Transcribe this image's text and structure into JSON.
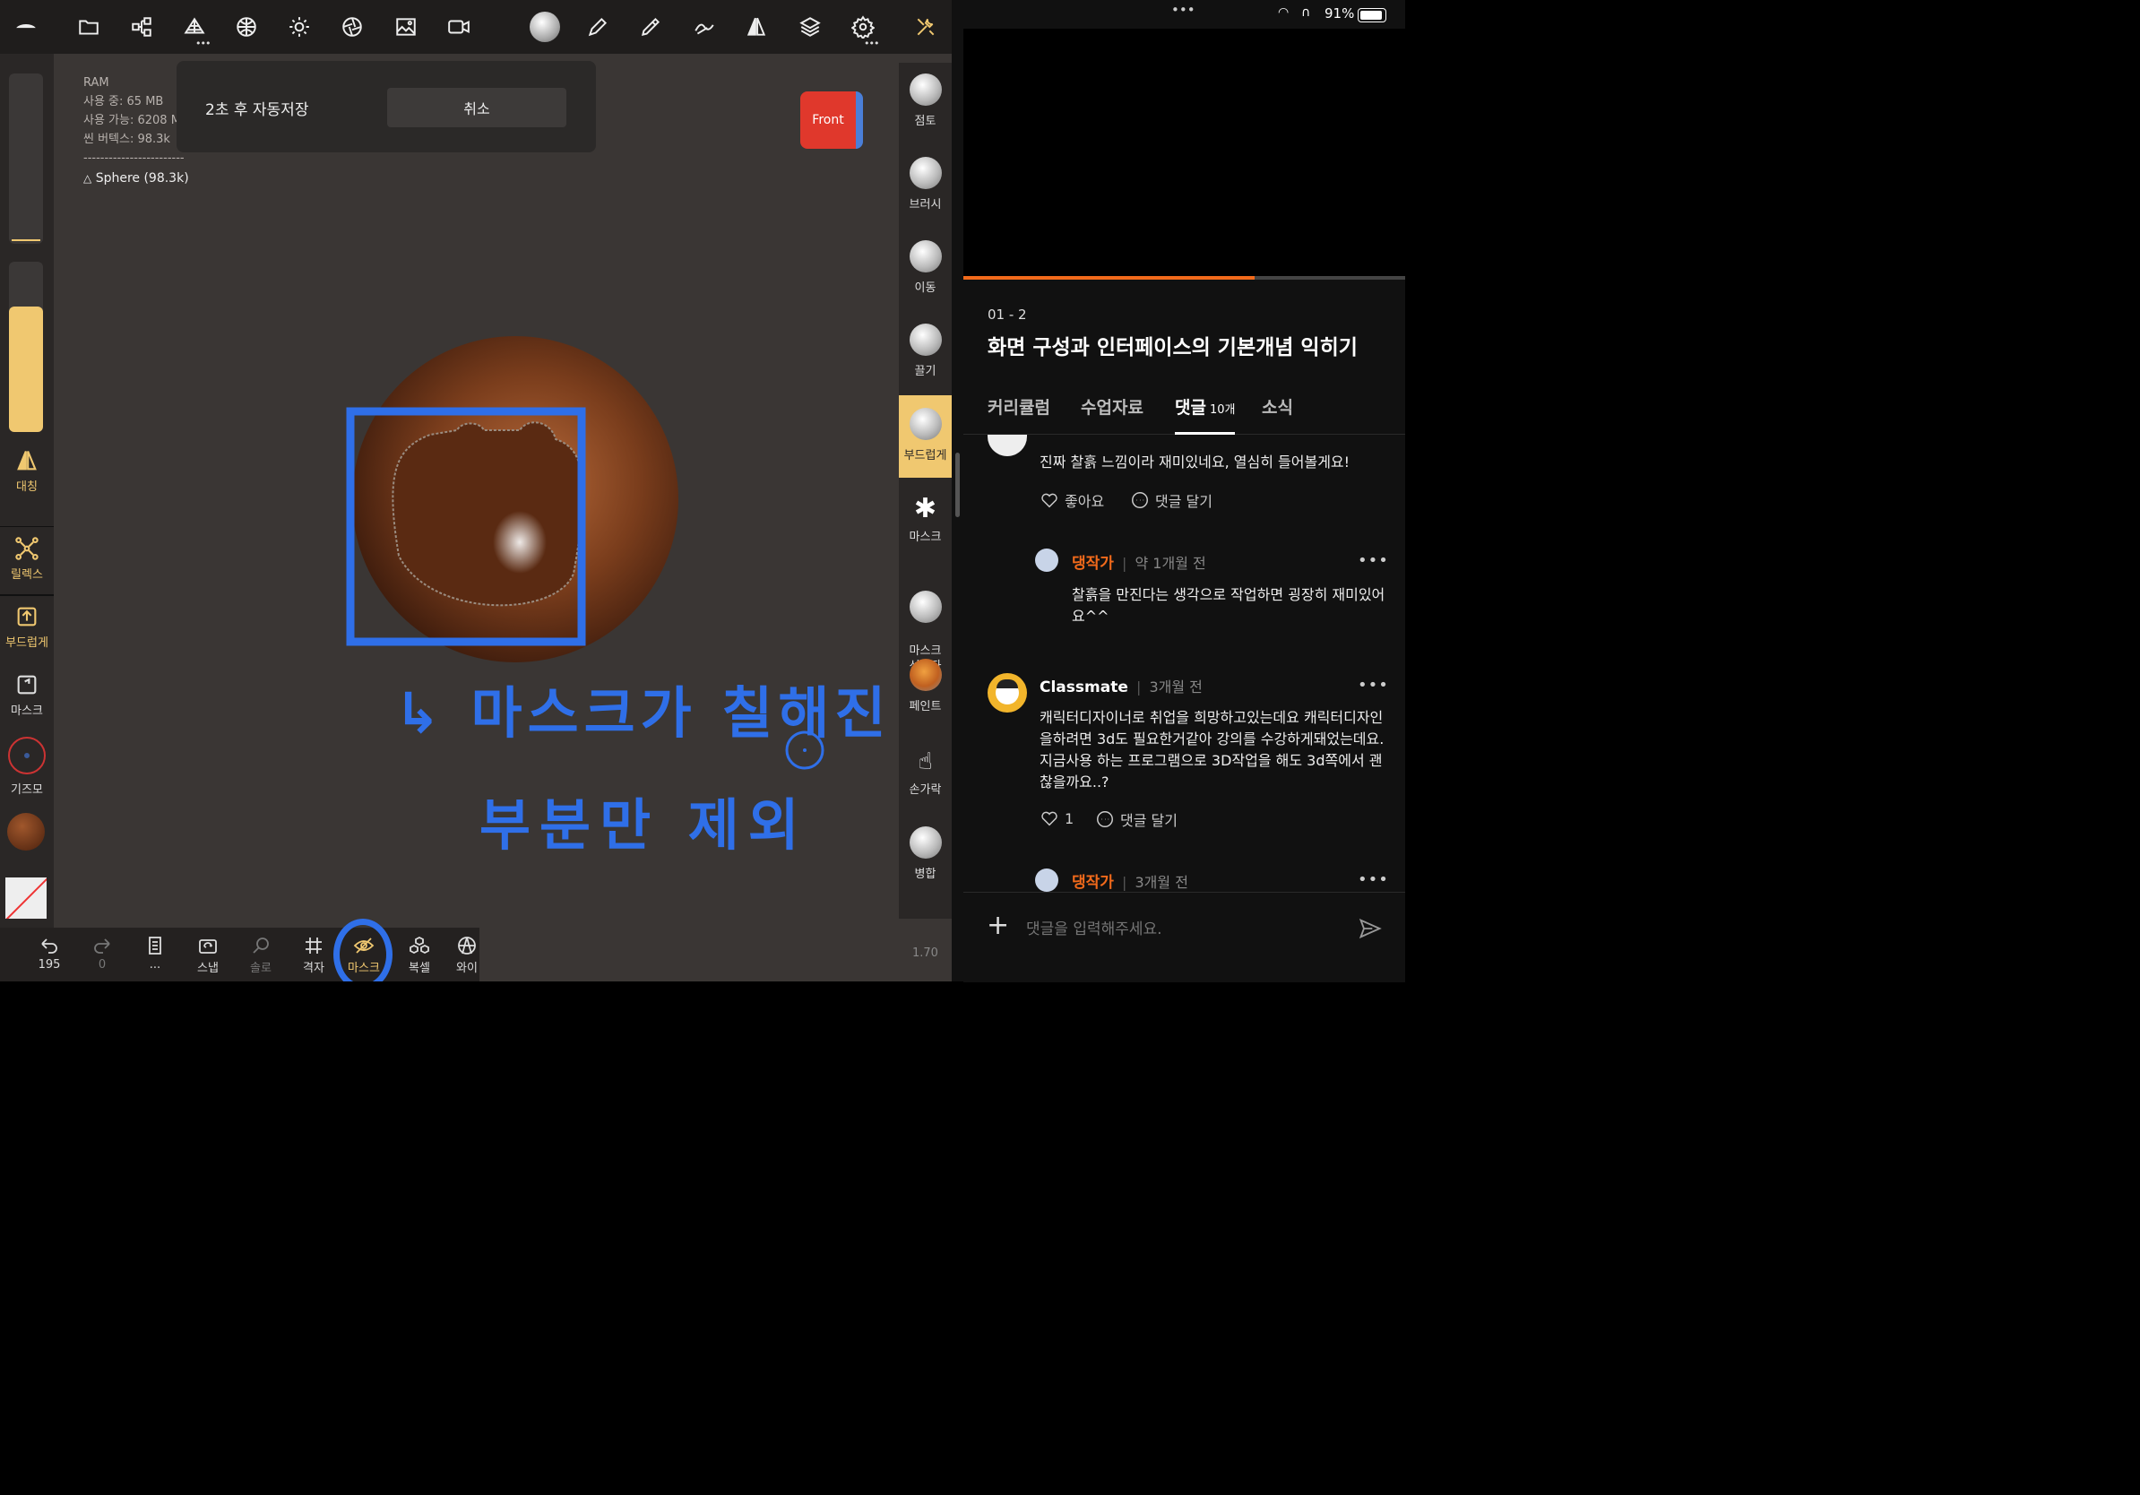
{
  "left_app": {
    "toolbar": {
      "icons": [
        "logo-icon",
        "folder-icon",
        "scene-graph-icon",
        "mesh-icon",
        "sphere-grid-icon",
        "sun-icon",
        "aperture-icon",
        "image-icon",
        "video-icon",
        "sphere-brush-icon",
        "pen-icon",
        "brush-icon",
        "stroke-icon",
        "mirror-icon",
        "layers-icon",
        "settings-icon",
        "tools-icon"
      ]
    },
    "stats": {
      "ram_label": "RAM",
      "used": "사용 중: 65 MB",
      "available": "사용 가능: 6208 M",
      "scene_vertices": "씬 버텍스: 98.3k",
      "separator": "------------------------",
      "object": "Sphere (98.3k)"
    },
    "autosave": {
      "message": "2초 후 자동저장",
      "cancel_label": "취소"
    },
    "viewcube_label": "Front",
    "left_panel": {
      "symmetry_label": "대칭",
      "relax_label": "릴렉스",
      "smooth_label": "부드럽게",
      "mask_label": "마스크",
      "gizmo_label": "기즈모"
    },
    "right_tools": [
      {
        "label": "점토"
      },
      {
        "label": "브러시"
      },
      {
        "label": "이동"
      },
      {
        "label": "끌기"
      },
      {
        "label": "부드럽게"
      },
      {
        "label": "마스크"
      },
      {
        "label": "마스크\n선택자"
      },
      {
        "label": "페인트"
      },
      {
        "label": "손가락"
      },
      {
        "label": "병합"
      }
    ],
    "bottom_bar": {
      "undo_count": "195",
      "redo_count": "0",
      "more_label": "...",
      "snap_label": "스냅",
      "solo_label": "솔로",
      "grid_label": "격자",
      "mask_label": "마스크",
      "clone_label": "복셀",
      "wire_label": "와이"
    },
    "zoom": "1.70",
    "annotation_line1": "↳ 마스크가 칠해진",
    "annotation_line2": "부분만 제외",
    "colors": {
      "accent": "#f0c870",
      "annotation": "#2f6fe8"
    }
  },
  "right_app": {
    "status": {
      "dots": "•••",
      "battery": "91%"
    },
    "progress_fraction": 0.66,
    "lesson_number": "01 - 2",
    "lesson_title": "화면 구성과 인터페이스의 기본개념 익히기",
    "tabs": [
      {
        "label": "커리큘럼"
      },
      {
        "label": "수업자료"
      },
      {
        "label": "댓글",
        "count": "10개",
        "active": true
      },
      {
        "label": "소식"
      }
    ],
    "comments": [
      {
        "text": "진짜 찰흙 느낌이라 재미있네요, 열심히 들어볼게요!",
        "like_label": "좋아요",
        "reply_label": "댓글 달기"
      },
      {
        "author": "댕작가",
        "time": "약 1개월 전",
        "text": "찰흙을 만진다는 생각으로 작업하면 굉장히 재미있어요^^"
      },
      {
        "author": "Classmate",
        "time": "3개월 전",
        "text": "캐릭터디자이너로 취업을 희망하고있는데요 캐릭터디자인을하려면 3d도 필요한거같아 강의를 수강하게돼었는데요. 지금사용 하는 프로그램으로 3D작업을 해도 3d쪽에서 괜찮을까요..?",
        "like_count": "1",
        "reply_label": "댓글 달기"
      },
      {
        "author": "댕작가",
        "time": "3개월 전"
      }
    ],
    "comment_input_placeholder": "댓글을 입력해주세요.",
    "colors": {
      "accent": "#f26a1b"
    }
  }
}
